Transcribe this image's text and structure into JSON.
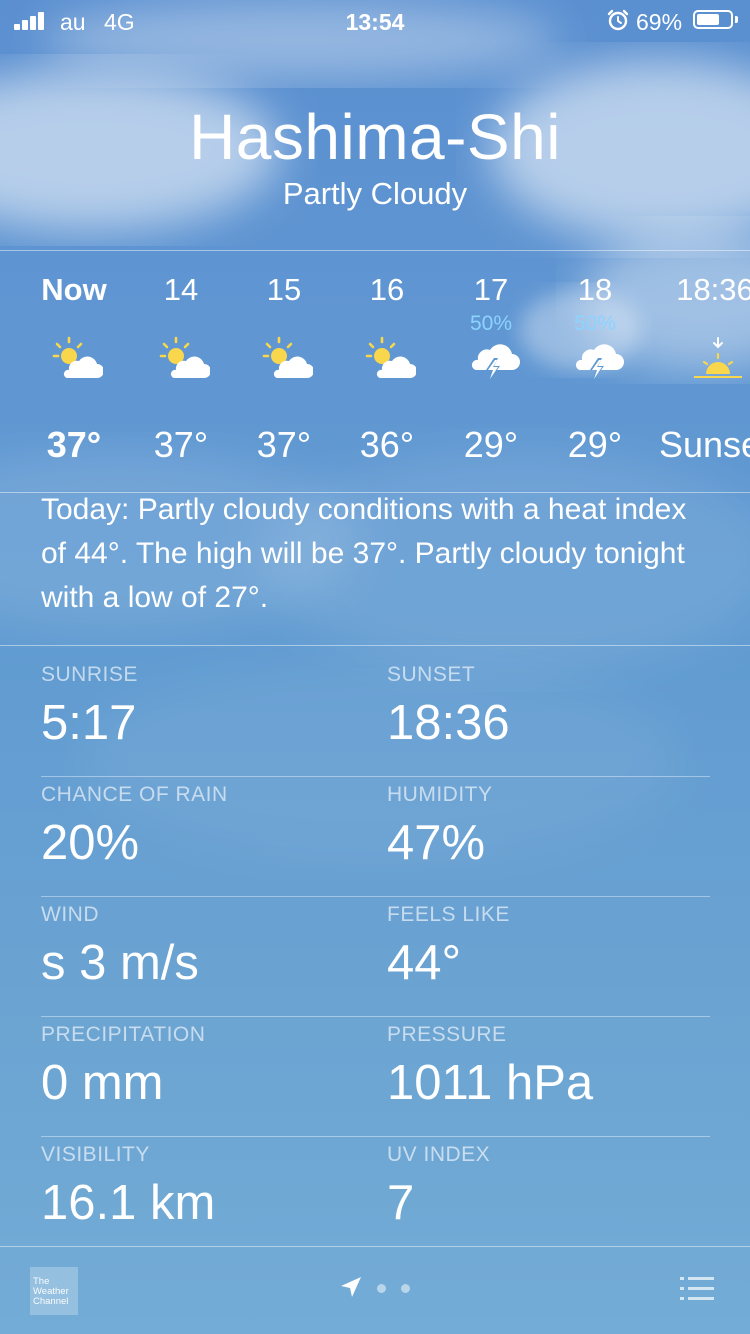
{
  "status_bar": {
    "carrier": "au",
    "network": "4G",
    "time": "13:54",
    "battery_percent": "69%",
    "battery_level": 0.69
  },
  "header": {
    "city": "Hashima-Shi",
    "condition": "Partly Cloudy"
  },
  "hourly": [
    {
      "time": "Now",
      "pop": "",
      "icon": "partly-cloudy-icon",
      "temp": "37°"
    },
    {
      "time": "14",
      "pop": "",
      "icon": "partly-cloudy-icon",
      "temp": "37°"
    },
    {
      "time": "15",
      "pop": "",
      "icon": "partly-cloudy-icon",
      "temp": "37°"
    },
    {
      "time": "16",
      "pop": "",
      "icon": "partly-cloudy-icon",
      "temp": "36°"
    },
    {
      "time": "17",
      "pop": "50%",
      "icon": "thunderstorm-icon",
      "temp": "29°"
    },
    {
      "time": "18",
      "pop": "50%",
      "icon": "thunderstorm-icon",
      "temp": "29°"
    },
    {
      "time": "18:36",
      "pop": "",
      "icon": "sunset-icon",
      "temp": "Sunset"
    }
  ],
  "summary": "Today: Partly cloudy conditions with a heat index of 44°. The high will be 37°. Partly cloudy tonight with a low of 27°.",
  "details": [
    {
      "left": {
        "label": "SUNRISE",
        "value": "5:17"
      },
      "right": {
        "label": "SUNSET",
        "value": "18:36"
      }
    },
    {
      "left": {
        "label": "CHANCE OF RAIN",
        "value": "20%"
      },
      "right": {
        "label": "HUMIDITY",
        "value": "47%"
      }
    },
    {
      "left": {
        "label": "WIND",
        "value": "s 3 m/s"
      },
      "right": {
        "label": "FEELS LIKE",
        "value": "44°"
      }
    },
    {
      "left": {
        "label": "PRECIPITATION",
        "value": "0 mm"
      },
      "right": {
        "label": "PRESSURE",
        "value": "1011 hPa"
      }
    },
    {
      "left": {
        "label": "VISIBILITY",
        "value": "16.1 km"
      },
      "right": {
        "label": "UV INDEX",
        "value": "7"
      }
    }
  ],
  "toolbar": {
    "logo_line1": "The",
    "logo_line2": "Weather",
    "logo_line3": "Channel",
    "page_count": 3,
    "current_page": 0
  },
  "colors": {
    "background_top": "#5a8fd0",
    "background_bottom": "#73acd6",
    "sun": "#f8d74c",
    "precip_chance": "#8cd3ff"
  }
}
